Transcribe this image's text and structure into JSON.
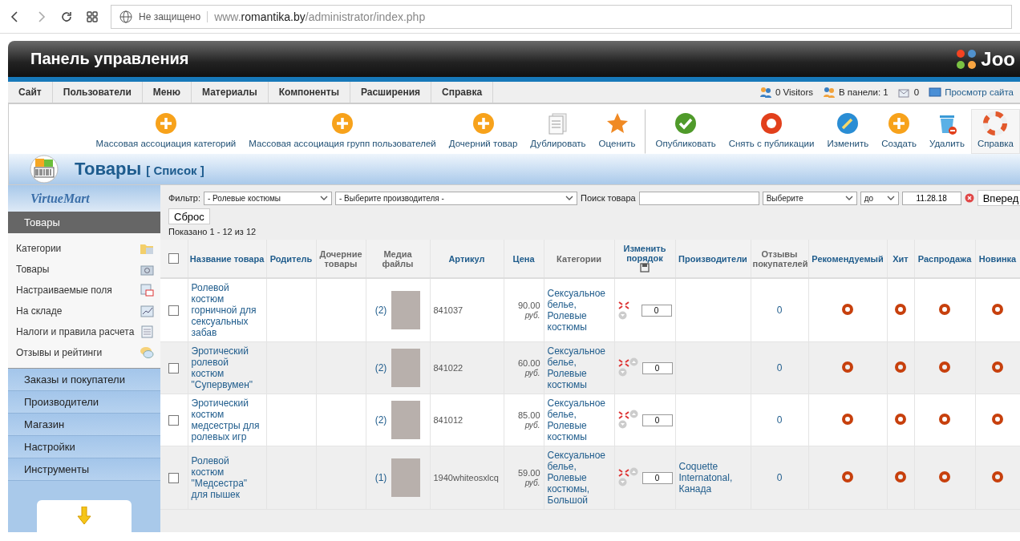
{
  "browser": {
    "security": "Не защищено",
    "url": [
      {
        "text": "www.",
        "strong": false
      },
      {
        "text": "romantika.by",
        "strong": true
      },
      {
        "text": "/administrator/index.php",
        "strong": false
      }
    ]
  },
  "header": {
    "title": "Панель управления",
    "logo_text": "Joo"
  },
  "menu": [
    "Сайт",
    "Пользователи",
    "Меню",
    "Материалы",
    "Компоненты",
    "Расширения",
    "Справка"
  ],
  "status": [
    {
      "kind": "visitors",
      "text": "0 Visitors"
    },
    {
      "kind": "admins",
      "text": "В панели: 1"
    },
    {
      "kind": "messages",
      "text": "0"
    },
    {
      "kind": "preview",
      "text": "Просмотр сайта"
    }
  ],
  "toolbar": [
    {
      "label": "Массовая ассоциация категорий",
      "kind": "plus",
      "separator_before": false,
      "highlighted": false
    },
    {
      "label": "Массовая ассоциация групп пользователей",
      "kind": "plus",
      "separator_before": false,
      "highlighted": false
    },
    {
      "label": "Дочерний товар",
      "kind": "plus",
      "separator_before": false,
      "highlighted": false
    },
    {
      "label": "Дублировать",
      "kind": "copy",
      "separator_before": false,
      "highlighted": false
    },
    {
      "label": "Оценить",
      "kind": "star",
      "separator_before": false,
      "highlighted": false
    },
    {
      "label": "Опубликовать",
      "kind": "check",
      "separator_before": true,
      "highlighted": false
    },
    {
      "label": "Снять с публикации",
      "kind": "stop",
      "separator_before": false,
      "highlighted": false
    },
    {
      "label": "Изменить",
      "kind": "pencil",
      "separator_before": false,
      "highlighted": false
    },
    {
      "label": "Создать",
      "kind": "plus",
      "separator_before": false,
      "highlighted": false
    },
    {
      "label": "Удалить",
      "kind": "trash",
      "separator_before": false,
      "highlighted": false
    },
    {
      "label": "Справка",
      "kind": "help",
      "separator_before": false,
      "highlighted": true
    }
  ],
  "page_title": {
    "title": "Товары",
    "subtitle": "[ Список ]"
  },
  "sidebar": {
    "logo_text": "VirtueMart",
    "heading": "Товары",
    "items": [
      {
        "label": "Категории",
        "kind": "folder"
      },
      {
        "label": "Товары",
        "kind": "camera"
      },
      {
        "label": "Настраиваемые поля",
        "kind": "form"
      },
      {
        "label": "На складе",
        "kind": "chart"
      },
      {
        "label": "Налоги и правила расчета",
        "kind": "calculator"
      },
      {
        "label": "Отзывы и рейтинги",
        "kind": "chat"
      }
    ],
    "sections": [
      "Заказы и покупатели",
      "Производители",
      "Магазин",
      "Настройки",
      "Инструменты"
    ]
  },
  "filter": {
    "label": "Фильтр:",
    "category": "- Ролевые костюмы",
    "manufacturer": "- Выберите производителя -",
    "search_label": "Поиск товара",
    "date_mode": "Выберите",
    "date_op": "до",
    "date": "11.28.18",
    "go": "Вперед",
    "reset": "Сброс",
    "summary": "Показано 1 - 12 из 12"
  },
  "table": {
    "select_all_checked": false,
    "columns": [
      {
        "kind": "check"
      },
      {
        "kind": "name",
        "label": "Название товара",
        "sortable": true
      },
      {
        "kind": "parent",
        "label": "Родитель",
        "sortable": true
      },
      {
        "kind": "children",
        "label": "Дочерние товары",
        "sortable": false
      },
      {
        "kind": "media",
        "label": "Медиа файлы",
        "sortable": false
      },
      {
        "kind": "sku",
        "label": "Артикул",
        "sortable": true
      },
      {
        "kind": "price",
        "label": "Цена",
        "sortable": true
      },
      {
        "kind": "categories",
        "label": "Категории",
        "sortable": false
      },
      {
        "kind": "order",
        "label": "Изменить порядок",
        "sortable": true
      },
      {
        "kind": "manufacturer",
        "label": "Производители",
        "sortable": true
      },
      {
        "kind": "reviews",
        "label": "Отзывы покупателей",
        "sortable": false
      },
      {
        "kind": "flag",
        "label": "Рекомендуемый",
        "sortable": true
      },
      {
        "kind": "flag",
        "label": "Хит",
        "sortable": true
      },
      {
        "kind": "flag",
        "label": "Распродажа",
        "sortable": true
      },
      {
        "kind": "flag",
        "label": "Новинка",
        "sortable": true
      }
    ],
    "rows": [
      {
        "checked": false,
        "name": "Ролевой костюм горничной для сексуальных забав",
        "media": "(2)",
        "sku": "841037",
        "price": "90.00",
        "currency": "руб.",
        "categories": "Сексуальное белье, Ролевые костюмы",
        "can_move_up": false,
        "order": "0",
        "reviews": "0"
      },
      {
        "checked": false,
        "name": "Эротический ролевой костюм \"Супервумен\"",
        "media": "(2)",
        "sku": "841022",
        "price": "60.00",
        "currency": "руб.",
        "categories": "Сексуальное белье, Ролевые костюмы",
        "can_move_up": true,
        "order": "0",
        "reviews": "0"
      },
      {
        "checked": false,
        "name": "Эротический костюм медсестры для ролевых игр",
        "media": "(2)",
        "sku": "841012",
        "price": "85.00",
        "currency": "руб.",
        "categories": "Сексуальное белье, Ролевые костюмы",
        "can_move_up": true,
        "order": "0",
        "reviews": "0"
      },
      {
        "checked": false,
        "name": "Ролевой костюм \"Медсестра\" для пышек",
        "media": "(1)",
        "sku": "1940whiteosxlcq",
        "price": "59.00",
        "currency": "руб.",
        "categories": "Сексуальное белье, Ролевые костюмы, Большой",
        "can_move_up": true,
        "order": "0",
        "manufacturer": "Coquette Internatonal, Канада",
        "reviews": "0"
      }
    ]
  }
}
